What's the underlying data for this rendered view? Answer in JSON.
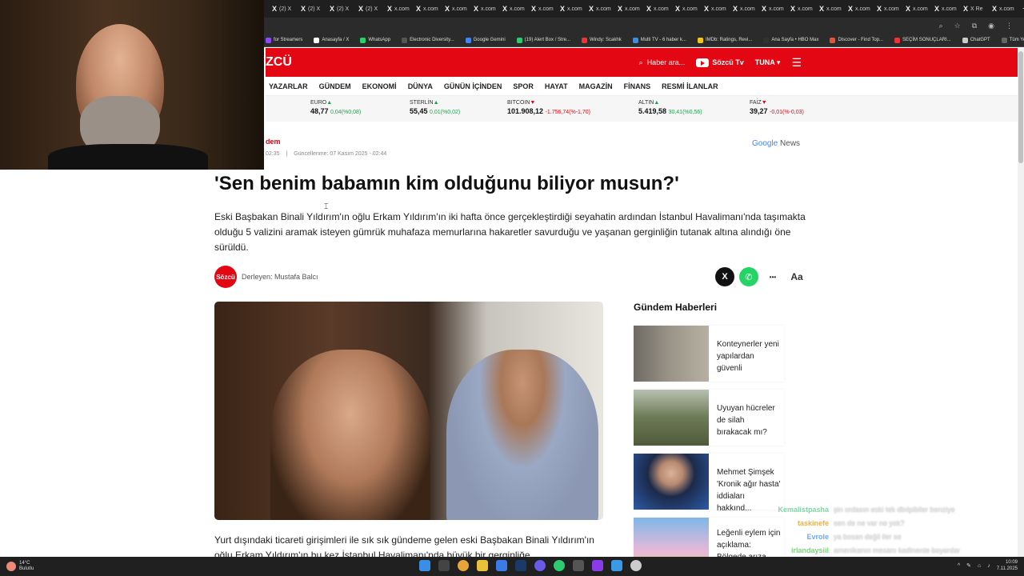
{
  "browser": {
    "tabs": [
      "(2) X",
      "(2) X",
      "(2) X",
      "(2) X",
      "x.com",
      "x.com",
      "x.com",
      "x.com",
      "x.com",
      "x.com",
      "x.com",
      "x.com",
      "x.com",
      "x.com",
      "x.com",
      "x.com",
      "x.com",
      "x.com",
      "x.com",
      "x.com",
      "x.com",
      "x.com",
      "x.com",
      "x.com",
      "X Re",
      "x.com"
    ],
    "new_tab": "+",
    "bookmarks": [
      "for Streamers",
      "Anasayfa / X",
      "WhatsApp",
      "Electronic Diversity...",
      "Google Gemini",
      "(19) Alert Box / Stre...",
      "Windy: Scakhk",
      "Multi TV - 6 haber k...",
      "IMDb: Ratings, Revi...",
      "Ana Sayfa • HBO Max",
      "Discover - Find Top...",
      "SEÇİM SONUÇLARI...",
      "ChatGPT",
      "Tüm Yer İşaretleri"
    ]
  },
  "site": {
    "logo": "ZCÜ",
    "search_label": "Haber ara...",
    "tv_label": "Sözcü Tv",
    "user_label": "TUNA",
    "nav": [
      "YAZARLAR",
      "GÜNDEM",
      "EKONOMİ",
      "DÜNYA",
      "GÜNÜN İÇİNDEN",
      "SPOR",
      "HAYAT",
      "MAGAZİN",
      "FİNANS",
      "RESMİ İLANLAR"
    ]
  },
  "ticker": [
    {
      "name": "EURO",
      "dir": "up",
      "value": "48,77",
      "change": "0,04(%0,08)"
    },
    {
      "name": "STERLİN",
      "dir": "up",
      "value": "55,45",
      "change": "0,01(%0,02)"
    },
    {
      "name": "BITCOIN",
      "dir": "down",
      "value": "101.908,12",
      "change": "-1.756,74(%-1,70)"
    },
    {
      "name": "ALTIN",
      "dir": "up",
      "value": "5.419,58",
      "change": "30,41(%0,56)"
    },
    {
      "name": "FAİZ",
      "dir": "down",
      "value": "39,27",
      "change": "-0,01(%-0,03)"
    }
  ],
  "article": {
    "category": "dem",
    "published_time": "02:35",
    "updated": "Güncellenme: 07 Kasım 2025 - 02:44",
    "google_news_1": "Google",
    "google_news_2": "News",
    "title": "'Sen benim babamın kim olduğunu biliyor musun?'",
    "summary": "Eski Başbakan Binali Yıldırım'ın oğlu Erkam Yıldırım'ın iki hafta önce gerçekleştirdiği seyahatin ardından İstanbul Havalimanı'nda taşımakta olduğu 5 valizini aramak isteyen gümrük muhafaza memurlarına hakaretler savurduğu ve yaşanan gerginliğin tutanak altına alındığı öne sürüldü.",
    "author_logo": "Sözcü",
    "author": "Derleyen: Mustafa Balcı",
    "body": "Yurt dışındaki ticareti girişimleri ile sık sık gündeme gelen eski Başbakan Binali Yıldırım'ın oğlu Erkam Yıldırım'ın bu kez İstanbul Havalimanı'nda büyük bir gerginliğe",
    "share_x": "X",
    "share_more": "•••",
    "font_size": "Aa"
  },
  "sidebar": {
    "title": "Gündem Haberleri",
    "items": [
      {
        "text": "Konteynerler yeni yapılardan güvenli"
      },
      {
        "text": "Uyuyan hücreler de silah bırakacak mı?"
      },
      {
        "text": "Mehmet Şimşek 'Kronik ağır hasta' iddiaları hakkınd..."
      },
      {
        "text": "Leğenli eylem için açıklama: Bölgede arıza var..."
      }
    ]
  },
  "chat": [
    {
      "user": "Kemalistpasha",
      "color": "#7ed6a5",
      "msg": "şin ordasın eski tek dbılpibiler benziye"
    },
    {
      "user": "taskinefe",
      "color": "#f0b040",
      "msg": "sen de ne var ne yok?"
    },
    {
      "user": "Evrole",
      "color": "#6aa8ff",
      "msg": "ya bosan değil iler se"
    },
    {
      "user": "irlandaysiil",
      "color": "#7ed67e",
      "msg": "amenikanın mesanı kadinente boyardar"
    },
    {
      "user": "Evrole",
      "color": "#6aa8ff",
      "msg": ""
    }
  ],
  "taskbar": {
    "temp": "14°C",
    "weather": "Bulutlu",
    "time": "10:09",
    "date": "7.11.2025"
  }
}
